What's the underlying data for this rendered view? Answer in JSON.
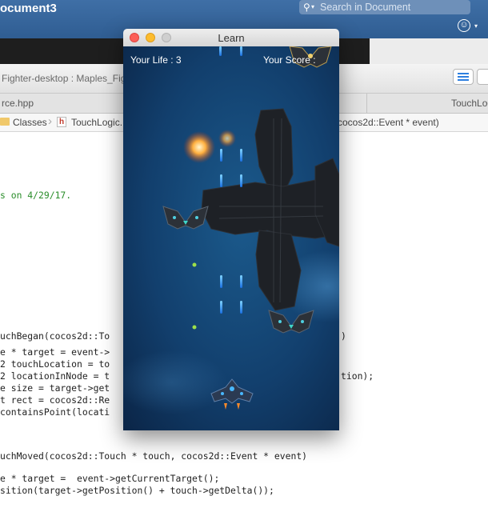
{
  "word": {
    "doc_title": "ocument3",
    "search_placeholder": "Search in Document"
  },
  "xcode": {
    "scheme": "Fighter-desktop : Maples_Fig",
    "tabs": [
      "rce.hpp",
      "TouchLog"
    ],
    "jumpbar": {
      "folder": "Classes",
      "file": "TouchLogic.",
      "func": "cocos2d::Event * event)"
    },
    "code_lines": [
      {
        "text": "s on 4/29/17.",
        "color": "green"
      },
      {
        "text": "uchBegan(cocos2d::To",
        "color": "normal"
      },
      {
        "text": "e * target = event->",
        "color": "normal"
      },
      {
        "text": "2 touchLocation = to",
        "color": "normal"
      },
      {
        "text": "2 locationInNode = t",
        "color": "normal"
      },
      {
        "text": "e size = target->get",
        "color": "normal"
      },
      {
        "text": "t rect = cocos2d::Re",
        "color": "normal"
      },
      {
        "text": "containsPoint(locati",
        "color": "normal"
      },
      {
        "text": "uchMoved(cocos2d::Touch * touch, cocos2d::Event * event)",
        "color": "normal"
      },
      {
        "text": "e * target =  event->getCurrentTarget();",
        "color": "normal"
      },
      {
        "text": "sition(target->getPosition() + touch->getDelta());",
        "color": "normal"
      }
    ],
    "right_fragments": [
      ")",
      "tion);"
    ]
  },
  "learn": {
    "title": "Learn",
    "hud_life": "Your Life : 3",
    "hud_score": "Your Score : "
  }
}
